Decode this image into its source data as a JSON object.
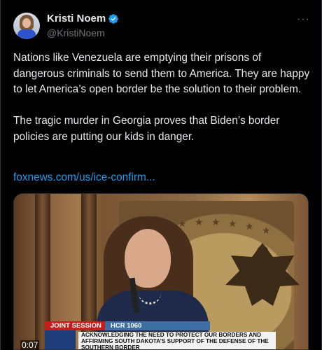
{
  "author": {
    "display_name": "Kristi Noem",
    "handle": "@KristiNoem",
    "avatar_icon": "profile-avatar",
    "verified_icon": "verified-badge-icon"
  },
  "more_icon": "more-horizontal-icon",
  "tweet": {
    "text": "Nations like Venezuela are emptying their prisons of dangerous criminals to send them to America. They are happy to let America’s open border be the solution to their problem.\n\nThe tragic murder in Georgia proves that Biden’s border policies are putting our kids in danger.",
    "link": "foxnews.com/us/ice-confirm..."
  },
  "video": {
    "tag": "JOINT SESSION",
    "bill": "HCR 1060",
    "caption": "ACKNOWLEDGING THE NEED TO PROTECT OUR BORDERS AND\nAFFIRMING SOUTH DAKOTA’S SUPPORT OF THE DEFENSE OF THE\nSOUTHERN BORDER",
    "time": "0:07"
  },
  "colors": {
    "link": "#1d9bf0",
    "verified": "#1d9bf0",
    "tag_red": "#c51c1c",
    "bill_blue": "#3d6fa5"
  }
}
